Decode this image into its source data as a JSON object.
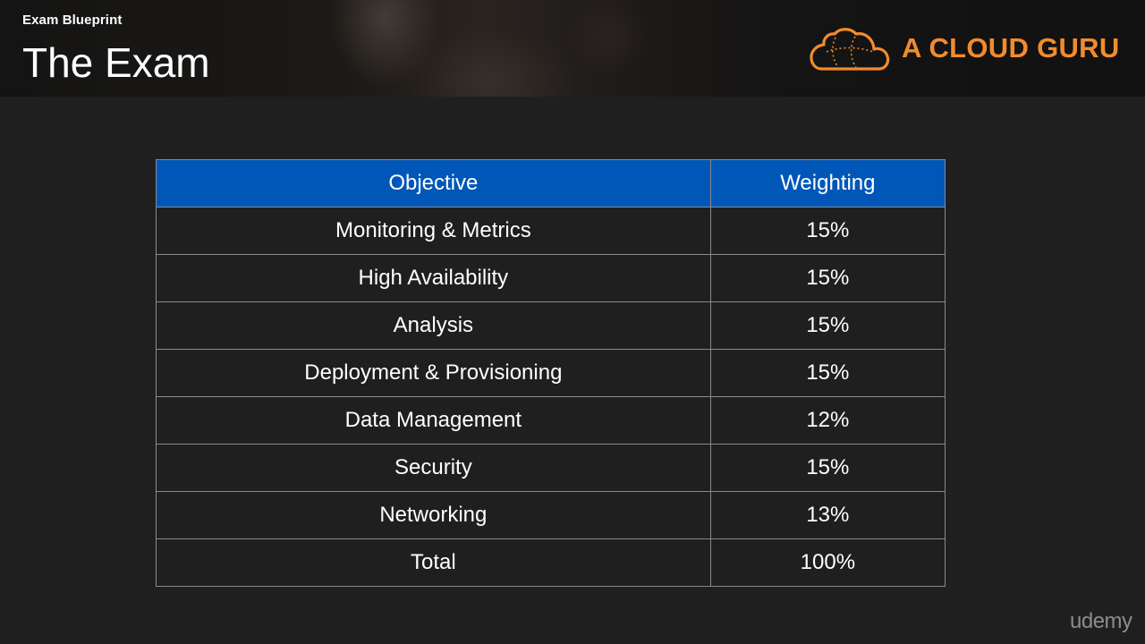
{
  "header": {
    "eyebrow": "Exam Blueprint",
    "title": "The Exam",
    "logo_text": "A CLOUD GURU",
    "logo_icon": "cloud-logo-icon"
  },
  "table": {
    "columns": [
      "Objective",
      "Weighting"
    ],
    "rows": [
      {
        "objective": "Monitoring & Metrics",
        "weighting": "15%"
      },
      {
        "objective": "High Availability",
        "weighting": "15%"
      },
      {
        "objective": "Analysis",
        "weighting": "15%"
      },
      {
        "objective": "Deployment & Provisioning",
        "weighting": "15%"
      },
      {
        "objective": "Data Management",
        "weighting": "12%"
      },
      {
        "objective": "Security",
        "weighting": "15%"
      },
      {
        "objective": "Networking",
        "weighting": "13%"
      },
      {
        "objective": "Total",
        "weighting": "100%"
      }
    ]
  },
  "watermark": "udemy",
  "colors": {
    "header_row": "#0057b8",
    "brand_orange": "#f28b2d",
    "background": "#1f1f1f"
  }
}
